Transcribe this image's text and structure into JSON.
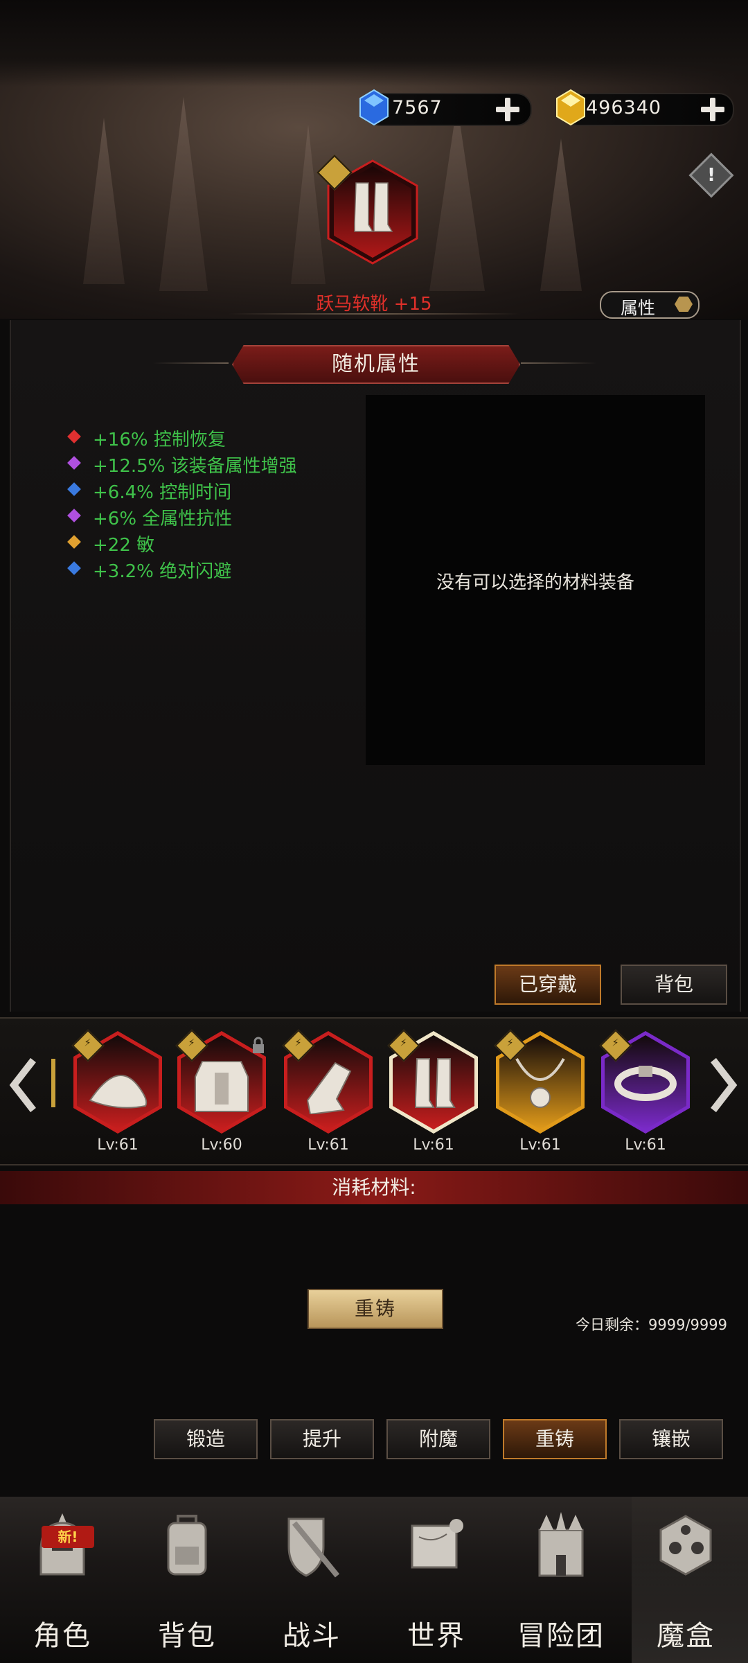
{
  "currency": {
    "gems": "7567",
    "gold": "496340"
  },
  "equipment": {
    "name": "跃马软靴 +15",
    "attr_button": "属性"
  },
  "random_attrs": {
    "title": "随机属性",
    "items": [
      {
        "text": "+16% 控制恢复",
        "gem_color": "#e03030"
      },
      {
        "text": "+12.5% 该装备属性增强",
        "gem_color": "#b050e0"
      },
      {
        "text": "+6.4% 控制时间",
        "gem_color": "#3a7ae0"
      },
      {
        "text": "+6% 全属性抗性",
        "gem_color": "#b050e0"
      },
      {
        "text": "+22 敏",
        "gem_color": "#e0a030"
      },
      {
        "text": "+3.2% 绝对闪避",
        "gem_color": "#3a7ae0"
      }
    ]
  },
  "material_box": {
    "empty_text": "没有可以选择的材料装备"
  },
  "filter_buttons": {
    "equipped": "已穿戴",
    "bag": "背包"
  },
  "equip_slots": [
    {
      "icon": "hat-icon",
      "level": "Lv:61",
      "rarity_color": "#c81e1e",
      "locked": false,
      "selected": false
    },
    {
      "icon": "armor-icon",
      "level": "Lv:60",
      "rarity_color": "#c81e1e",
      "locked": true,
      "selected": false
    },
    {
      "icon": "gauntlet-icon",
      "level": "Lv:61",
      "rarity_color": "#c81e1e",
      "locked": false,
      "selected": false
    },
    {
      "icon": "boots-icon",
      "level": "Lv:61",
      "rarity_color": "#c81e1e",
      "locked": false,
      "selected": true
    },
    {
      "icon": "necklace-icon",
      "level": "Lv:61",
      "rarity_color": "#e09a1a",
      "locked": false,
      "selected": false
    },
    {
      "icon": "belt-icon",
      "level": "Lv:61",
      "rarity_color": "#7a2ac8",
      "locked": false,
      "selected": false
    }
  ],
  "consume": {
    "label": "消耗材料:"
  },
  "recast": {
    "button": "重铸",
    "remaining": "今日剩余：9999/9999"
  },
  "tabs": [
    {
      "label": "锻造",
      "active": false
    },
    {
      "label": "提升",
      "active": false
    },
    {
      "label": "附魔",
      "active": false
    },
    {
      "label": "重铸",
      "active": true
    },
    {
      "label": "镶嵌",
      "active": false
    }
  ],
  "nav": {
    "new_badge": "新!",
    "items": [
      {
        "label": "角色",
        "icon": "helmet-icon"
      },
      {
        "label": "背包",
        "icon": "backpack-icon"
      },
      {
        "label": "战斗",
        "icon": "shield-sword-icon"
      },
      {
        "label": "世界",
        "icon": "map-scroll-icon"
      },
      {
        "label": "冒险团",
        "icon": "castle-icon"
      },
      {
        "label": "魔盒",
        "icon": "magic-box-icon"
      }
    ]
  }
}
